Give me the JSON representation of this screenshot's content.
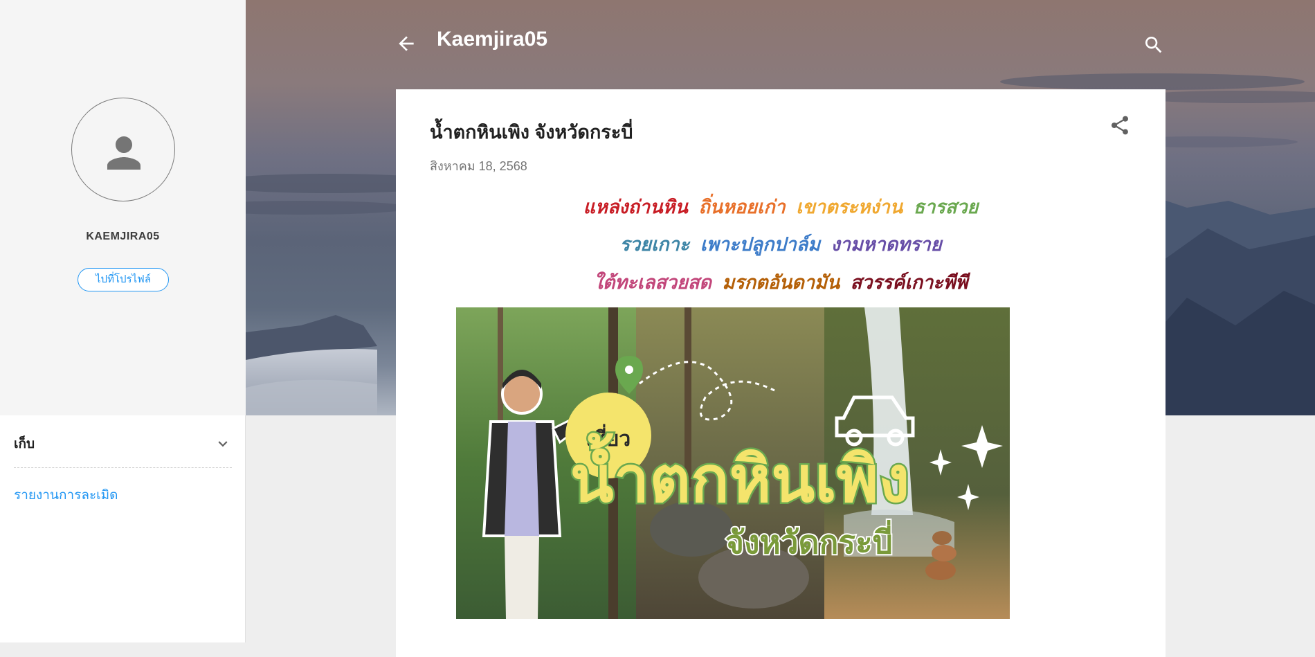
{
  "sidebar": {
    "profile_name": "KAEMJIRA05",
    "profile_button": "ไปที่โปรไฟล์",
    "archive_title": "เก็บ",
    "report_link": "รายงานการละเมิด"
  },
  "header": {
    "blog_title": "Kaemjira05"
  },
  "post": {
    "title": "น้ำตกหินเพิง จังหวัดกระบี่",
    "date": "สิงหาคม 18, 2568",
    "intro": {
      "line1": [
        "แหล่งถ่านหิน",
        "ถิ่นหอยเก่า",
        "เขาตระหง่าน",
        "ธารสวย"
      ],
      "line2": [
        "รวยเกาะ",
        "เพาะปลูกปาล์ม",
        "งามหาดทราย"
      ],
      "line3": [
        "ใต้ทะเลสวยสด",
        "มรกตอันดามัน",
        "สวรรค์เกาะพีพี"
      ]
    },
    "image": {
      "headline": "น้ำตกหินเพิง",
      "tag": "เที่ยว",
      "subtitle": "จังหวัดกระบี่"
    }
  },
  "colors": {
    "accent": "#2196f3",
    "sidebar_bg": "#f5f5f5",
    "page_bg": "#eeeeee"
  },
  "icons": [
    "person-icon",
    "chevron-down-icon",
    "back-arrow-icon",
    "search-icon",
    "share-icon",
    "location-pin-icon",
    "car-icon",
    "sparkle-icon"
  ]
}
